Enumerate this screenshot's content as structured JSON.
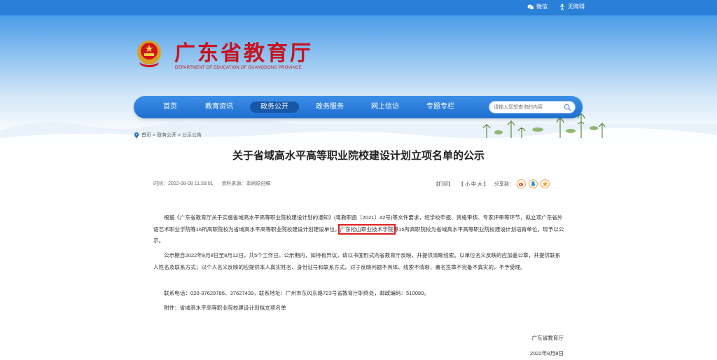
{
  "topbar": {
    "wechat_label": "微信",
    "accessibility_label": "无障碍"
  },
  "header": {
    "title": "广东省教育厅",
    "subtitle": "DEPARTMENT OF EDUCATION OF GUANGDONG PROVINCE"
  },
  "nav": {
    "items": [
      {
        "label": "首页",
        "active": false
      },
      {
        "label": "教育资讯",
        "active": false
      },
      {
        "label": "政务公开",
        "active": true
      },
      {
        "label": "政务服务",
        "active": false
      },
      {
        "label": "网上信访",
        "active": false
      },
      {
        "label": "专题专栏",
        "active": false
      }
    ]
  },
  "search": {
    "placeholder": "请输入您想查询的内容"
  },
  "breadcrumb": {
    "text": "首页 > 政务公开 > 公示公告"
  },
  "article": {
    "title": "关于省域高水平高等职业院校建设计划立项名单的公示",
    "time": "时间：2022-08-08 11:39:01",
    "source": "资料来源：本网原创稿",
    "print_label": "【打印】",
    "font_size_label": "【 小  中  大 】",
    "share_label": "分享到：",
    "p1_before": "根据《广东省教育厅关于实施省域高水平高等职业院校建设计划的通知》(粤教职函〔2021〕42号)等文件要求，经学校申报、资格审核、专家评审等环节，拟立项广东省外语艺术职业学院等16所高职院校为省域高水平高等职业院校建设计划建设单位，",
    "p1_highlight": "广东松山职业技术学院",
    "p1_after": "等15所高职院校为省域高水平高等职业院校建设计划培育单位。现予以公示。",
    "p2": "公示期自2022年8月8日至8月12日，共5个工作日。公示期内，如持有异议，请以书面形式向省教育厅反映，并提供清晰线索。以单位名义反映的应加盖公章，并提供联系人姓名及联系方式；以个人名义反映的应提供本人真实姓名、身份证号和联系方式。对于反映问题不具体、线索不清晰、署名签章不完备不真实的，不予受理。",
    "p3": "联系电话：020-37629786、37627439，联系地址：广州市东风东路723号省教育厅职终处，邮政编码：510080。",
    "p4": "附件：省域高水平高等职业院校建设计划拟立项名单",
    "signer": "广东省教育厅",
    "date": "2022年8月8日"
  },
  "colors": {
    "brand_red": "#c8141e",
    "nav_blue": "#1f6fd0",
    "highlight_red": "#e02020"
  }
}
